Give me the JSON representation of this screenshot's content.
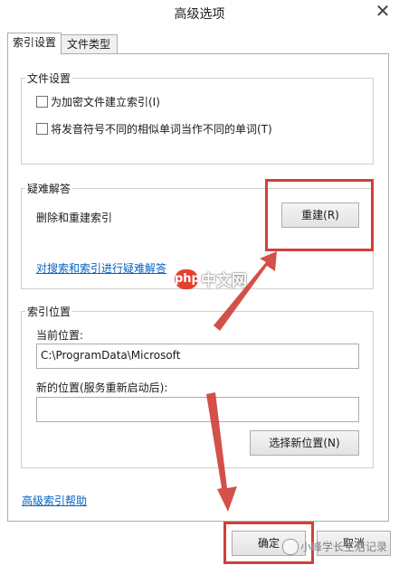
{
  "window": {
    "title": "高级选项",
    "close_glyph": "✕"
  },
  "tabs": [
    {
      "label": "索引设置"
    },
    {
      "label": "文件类型"
    }
  ],
  "file_settings": {
    "legend": "文件设置",
    "option1": "为加密文件建立索引(I)",
    "option2": "将发音符号不同的相似单词当作不同的单词(T)"
  },
  "troubleshoot": {
    "legend": "疑难解答",
    "delete_rebuild_text": "删除和重建索引",
    "rebuild_button": "重建(R)",
    "troubleshoot_link": "对搜索和索引进行疑难解答"
  },
  "index_location": {
    "legend": "索引位置",
    "current_label": "当前位置:",
    "current_value": "C:\\ProgramData\\Microsoft",
    "new_label": "新的位置(服务重新启动后):",
    "new_value": "",
    "select_button": "选择新位置(N)"
  },
  "help_link": "高级索引帮助",
  "footer": {
    "ok_button": "确定",
    "cancel_button": "取消"
  },
  "watermark": {
    "php_badge": "php",
    "site": "中文网",
    "account": "小峰学长生活记录"
  },
  "colors": {
    "highlight": "#d0413b",
    "link": "#0563c1",
    "arrow": "#d0413b"
  }
}
